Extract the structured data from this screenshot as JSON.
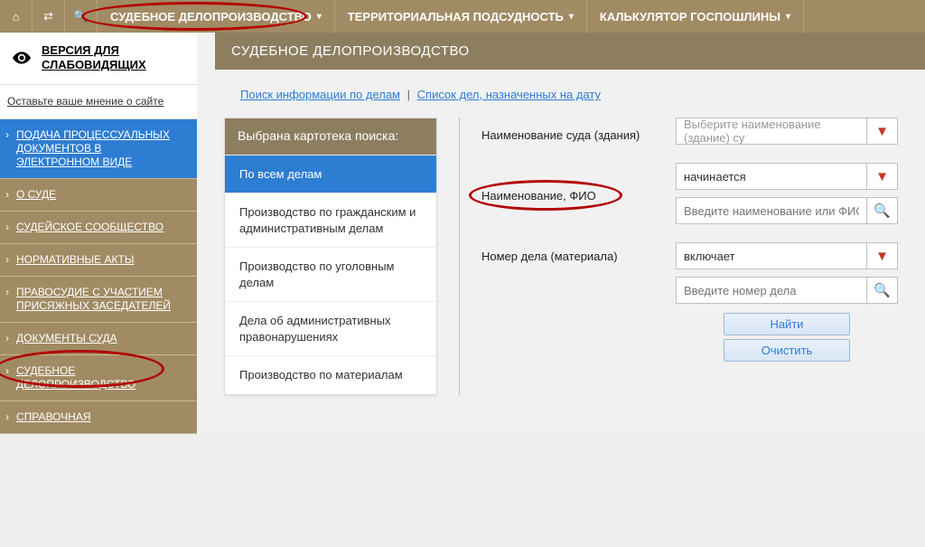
{
  "topnav": {
    "items": [
      {
        "label": "СУДЕБНОЕ ДЕЛОПРОИЗВОДСТВО"
      },
      {
        "label": "ТЕРРИТОРИАЛЬНАЯ ПОДСУДНОСТЬ"
      },
      {
        "label": "КАЛЬКУЛЯТОР ГОСПОШЛИНЫ"
      }
    ]
  },
  "accessibility": {
    "label": "ВЕРСИЯ ДЛЯ СЛАБОВИДЯЩИХ"
  },
  "feedback": {
    "label": "Оставьте ваше мнение о сайте"
  },
  "sidenav": {
    "items": [
      {
        "label": "ПОДАЧА ПРОЦЕССУАЛЬНЫХ ДОКУМЕНТОВ В ЭЛЕКТРОННОМ ВИДЕ",
        "style": "blue"
      },
      {
        "label": "О СУДЕ",
        "style": "brown"
      },
      {
        "label": "СУДЕЙСКОЕ СООБЩЕСТВО",
        "style": "brown"
      },
      {
        "label": "НОРМАТИВНЫЕ АКТЫ",
        "style": "brown"
      },
      {
        "label": "ПРАВОСУДИЕ С УЧАСТИЕМ ПРИСЯЖНЫХ ЗАСЕДАТЕЛЕЙ",
        "style": "brown"
      },
      {
        "label": "ДОКУМЕНТЫ СУДА",
        "style": "brown"
      },
      {
        "label": "СУДЕБНОЕ ДЕЛОПРОИЗВОДСТВО",
        "style": "brown"
      },
      {
        "label": "СПРАВОЧНАЯ",
        "style": "brown"
      }
    ]
  },
  "page": {
    "title": "СУДЕБНОЕ ДЕЛОПРОИЗВОДСТВО"
  },
  "sublinks": {
    "a": "Поиск информации по делам",
    "b": "Список дел, назначенных на дату"
  },
  "cartoteka": {
    "title": "Выбрана картотека поиска:",
    "items": [
      {
        "label": "По всем делам",
        "active": true
      },
      {
        "label": "Производство по гражданским и административным делам"
      },
      {
        "label": "Производство по уголовным делам"
      },
      {
        "label": "Дела об административных правонарушениях"
      },
      {
        "label": "Производство по материалам"
      }
    ]
  },
  "form": {
    "court_label": "Наименование суда (здания)",
    "fio_label": "Наименование, ФИО",
    "case_label": "Номер дела (материала)",
    "court_placeholder": "Выберите наименование (здание) су",
    "fio_mode": "начинается",
    "fio_placeholder": "Введите наименование или ФИО",
    "case_mode": "включает",
    "case_placeholder": "Введите номер дела",
    "find": "Найти",
    "clear": "Очистить"
  }
}
